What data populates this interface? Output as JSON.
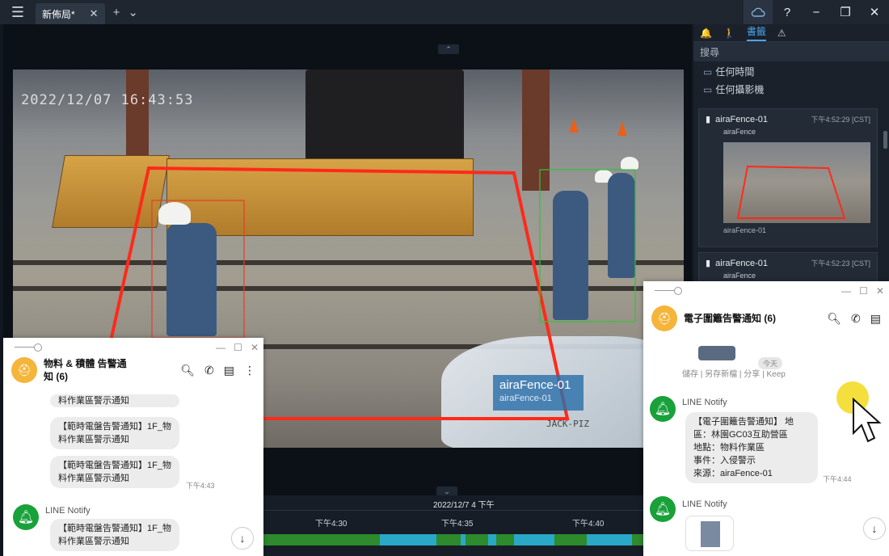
{
  "titlebar": {
    "tab_label": "新佈局*",
    "tab_close": "✕",
    "add_tab": "+",
    "tab_dropdown": "⌄",
    "help": "?",
    "minimize": "−",
    "restore": "❐",
    "close": "✕"
  },
  "video": {
    "timestamp": "2022/12/07 16:43:53",
    "fence_label": "airaFence-01",
    "fence_sublabel": "airaFence-01",
    "watermark": "JACK-PIZ"
  },
  "timeline": {
    "date_label": "2022/12/7 4 下午",
    "tick_labels": [
      "下午4:30",
      "下午4:35",
      "下午4:40"
    ]
  },
  "right_panel": {
    "tabs": [
      "🔔",
      "🚶",
      "書籤",
      "⚠"
    ],
    "search_label": "搜尋",
    "filter_time": "任何時間",
    "filter_camera": "任何攝影機",
    "cards": [
      {
        "name": "airaFence-01",
        "time": "下午4:52:29 [CST]",
        "sub": "airaFence",
        "caption": "airaFence-01"
      },
      {
        "name": "airaFence-01",
        "time": "下午4:52:23 [CST]",
        "sub": "airaFence"
      }
    ]
  },
  "line_left": {
    "title_line1": "物料 & 積體 告警通",
    "title_line2": "知 (6)",
    "msg_partial": "料作業區警示通知",
    "msg1": [
      "【範時電盤告警通知】1F_物",
      "料作業區警示通知"
    ],
    "msg2": [
      "【範時電盤告警通知】1F_物",
      "料作業區警示通知"
    ],
    "time2": "下午4:43",
    "sender": "LINE Notify",
    "msg3": [
      "【範時電盤告警通知】1F_物",
      "料作業區警示通知"
    ]
  },
  "line_right": {
    "title": "電子圍籬告警通知 (6)",
    "actions": "儲存 | 另存新檔 | 分享 | Keep",
    "today": "今天",
    "sender": "LINE Notify",
    "msg_lines": [
      "【電子圍籬告警通知】 地",
      "區：林園GC03互助營區",
      "地點：物料作業區",
      "事件：入侵警示",
      "來源：airaFence-01"
    ],
    "time": "下午4:44",
    "sender2": "LINE Notify"
  }
}
